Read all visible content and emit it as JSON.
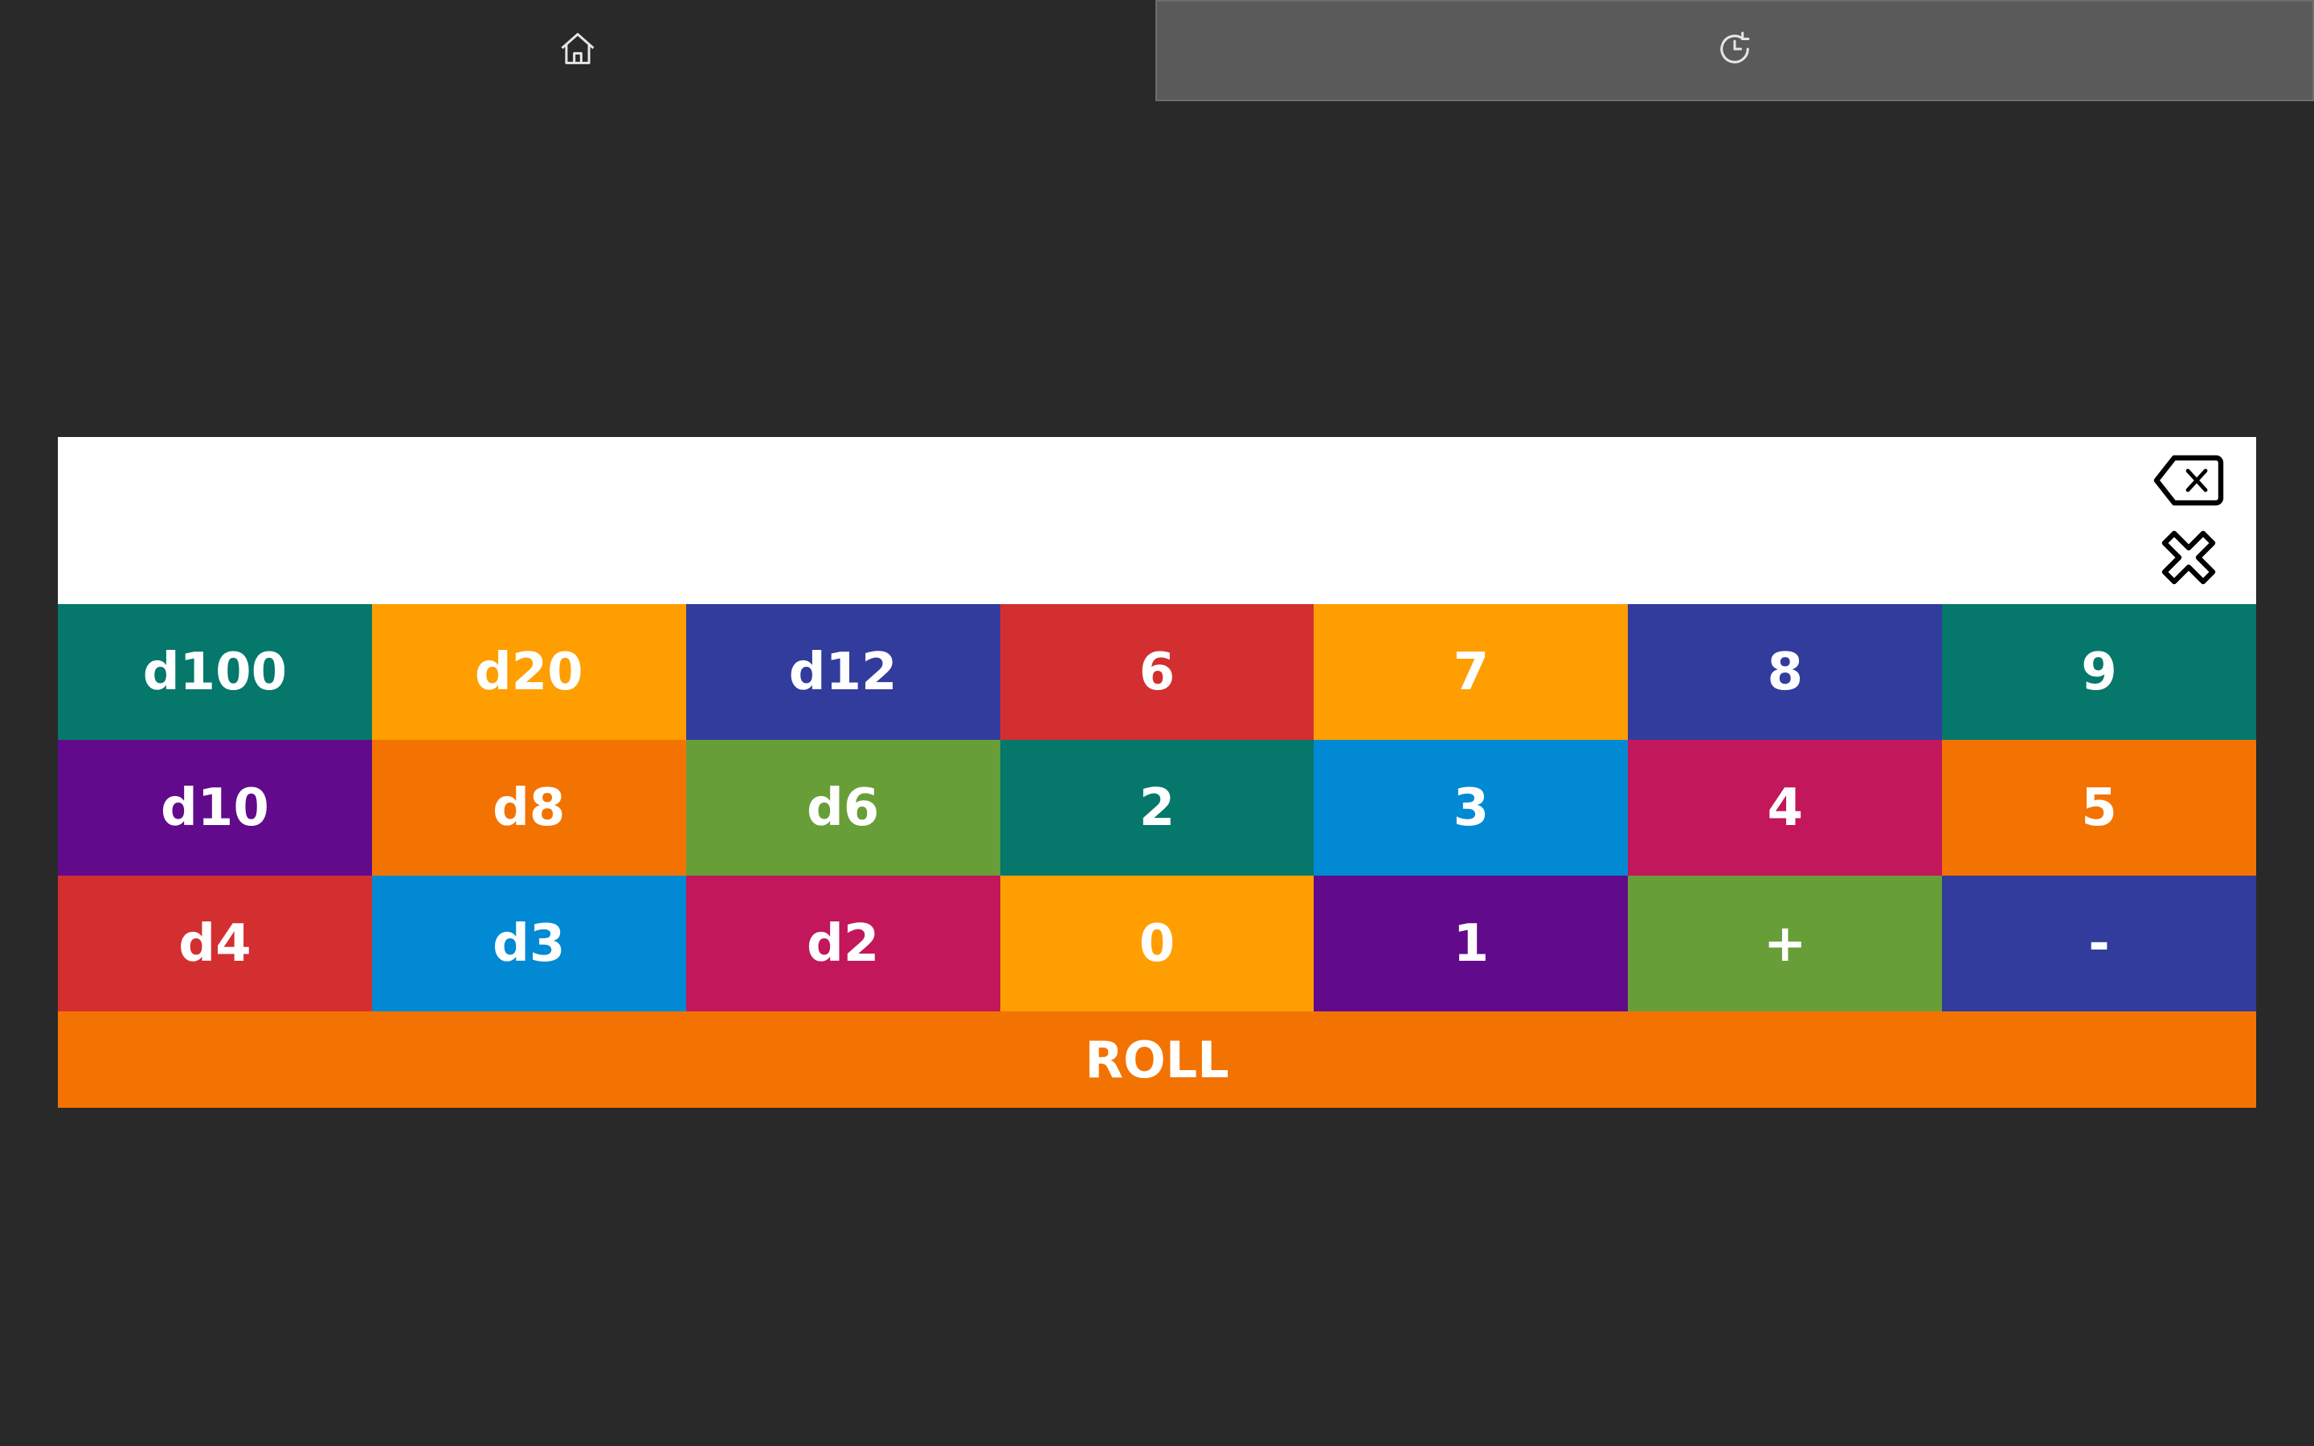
{
  "tabs": [
    {
      "icon": "home-icon",
      "active": false
    },
    {
      "icon": "history-icon",
      "active": true
    }
  ],
  "display": {
    "expression": "",
    "backspace_icon": "backspace-icon",
    "clear_icon": "clear-icon"
  },
  "keypad": {
    "rows": [
      [
        {
          "label": "d100",
          "color": "#05786b"
        },
        {
          "label": "d20",
          "color": "#fe9e00"
        },
        {
          "label": "d12",
          "color": "#323c9c"
        },
        {
          "label": "6",
          "color": "#d32f30"
        },
        {
          "label": "7",
          "color": "#fe9e00"
        },
        {
          "label": "8",
          "color": "#323c9c"
        },
        {
          "label": "9",
          "color": "#05786b"
        }
      ],
      [
        {
          "label": "d10",
          "color": "#610b8c"
        },
        {
          "label": "d8",
          "color": "#f37302"
        },
        {
          "label": "d6",
          "color": "#689e37"
        },
        {
          "label": "2",
          "color": "#05786b"
        },
        {
          "label": "3",
          "color": "#018ad3"
        },
        {
          "label": "4",
          "color": "#c2175a"
        },
        {
          "label": "5",
          "color": "#f37302"
        }
      ],
      [
        {
          "label": "d4",
          "color": "#d32f30"
        },
        {
          "label": "d3",
          "color": "#018ad3"
        },
        {
          "label": "d2",
          "color": "#c2175a"
        },
        {
          "label": "0",
          "color": "#fe9e00"
        },
        {
          "label": "1",
          "color": "#610b8c"
        },
        {
          "label": "+",
          "color": "#689e37"
        },
        {
          "label": "-",
          "color": "#323c9c"
        }
      ]
    ]
  },
  "roll_button": {
    "label": "ROLL",
    "color": "#f37302"
  }
}
